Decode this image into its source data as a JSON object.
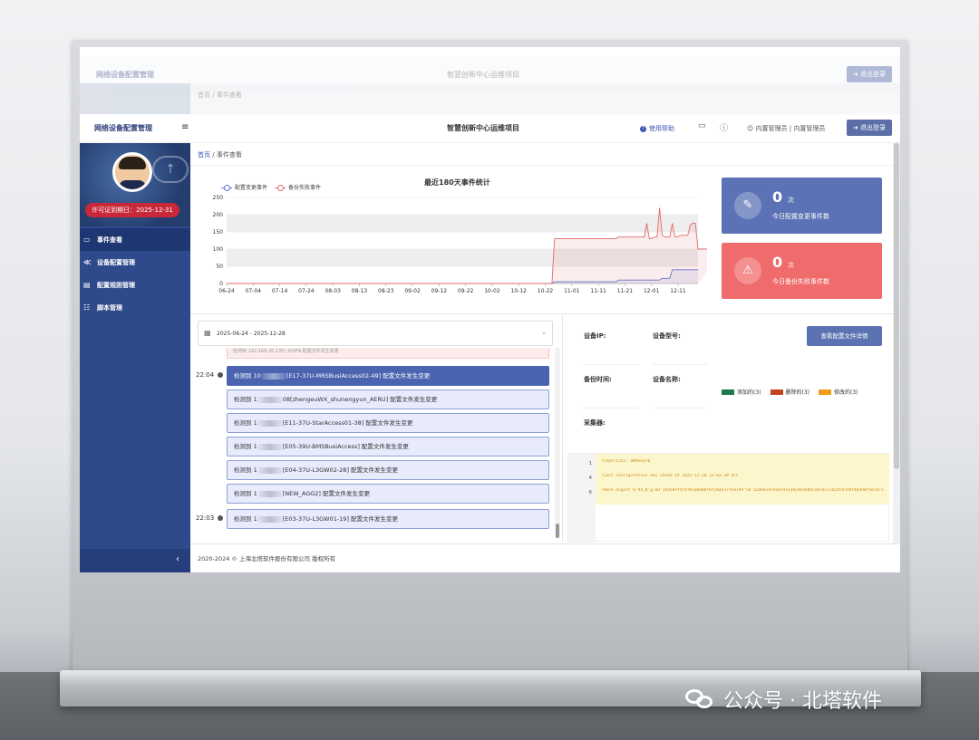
{
  "ghost": {
    "brand": "网络设备配置管理",
    "center_title": "智慧创新中心运维项目",
    "logout": "➜ 退出登录",
    "breadcrumb": "首页 / 事件查看"
  },
  "header": {
    "brand": "网络设备配置管理",
    "menu_toggle": "≡",
    "center_title": "智慧创新中心运维项目",
    "help": "使用帮助",
    "user": "内置管理员 | 内置管理员",
    "logout": "➜ 退出登录"
  },
  "sidebar": {
    "expire": "许可证到期日：2025-12-31",
    "items": [
      {
        "icon": "▭",
        "label": "事件查看",
        "active": true
      },
      {
        "icon": "≪",
        "label": "设备配置管理",
        "active": false
      },
      {
        "icon": "▤",
        "label": "配置规则管理",
        "active": false
      },
      {
        "icon": "☷",
        "label": "脚本管理",
        "active": false
      }
    ],
    "collapse": "‹"
  },
  "breadcrumb": {
    "home": "首页",
    "sep": "/",
    "current": "事件查看"
  },
  "chart_data": {
    "type": "line",
    "title": "最近180天事件统计",
    "series": [
      {
        "name": "配置变更事件",
        "color": "#5b73d6",
        "values": [
          0,
          0,
          0,
          0,
          0,
          0,
          0,
          0,
          0,
          0,
          0,
          0,
          0,
          0,
          0,
          0,
          0,
          0,
          0,
          0,
          0,
          0,
          0,
          0,
          0,
          0,
          0,
          0,
          0,
          0,
          0,
          0,
          0,
          0,
          0,
          0,
          0,
          0,
          0,
          0,
          0,
          0,
          0,
          0,
          0,
          0,
          0,
          0,
          0,
          0,
          0,
          0,
          0,
          0,
          0,
          0,
          0,
          0,
          0,
          0,
          0,
          0,
          0,
          0,
          0,
          0,
          0,
          0,
          0,
          0,
          0,
          0,
          0,
          0,
          0,
          0,
          0,
          0,
          0,
          0,
          0,
          0,
          0,
          0,
          0,
          0,
          0,
          0,
          0,
          0,
          0,
          0,
          0,
          0,
          0,
          0,
          0,
          0,
          0,
          0,
          0,
          0,
          0,
          0,
          0,
          0,
          0,
          0,
          0,
          0,
          0,
          0,
          0,
          0,
          0,
          0,
          0,
          0,
          0,
          0,
          0,
          0,
          0,
          0,
          0,
          0,
          0,
          0,
          5,
          5,
          5,
          5,
          5,
          5,
          5,
          5,
          5,
          5,
          5,
          5,
          5,
          5,
          5,
          5,
          5,
          5,
          5,
          5,
          5,
          5,
          5,
          5,
          5,
          10,
          10,
          10,
          10,
          10,
          10,
          10,
          10,
          10,
          10,
          10,
          10,
          10,
          10,
          10,
          10,
          10,
          15,
          15,
          15,
          15,
          40,
          40,
          40,
          40,
          40,
          40,
          40,
          40,
          40,
          40,
          40
        ]
      },
      {
        "name": "备份失败事件",
        "color": "#e06a6a",
        "values": [
          0,
          0,
          0,
          0,
          0,
          0,
          0,
          0,
          0,
          0,
          0,
          0,
          0,
          0,
          0,
          0,
          0,
          0,
          0,
          0,
          0,
          0,
          0,
          0,
          0,
          0,
          0,
          0,
          0,
          0,
          0,
          0,
          0,
          0,
          0,
          0,
          0,
          0,
          0,
          0,
          0,
          0,
          0,
          0,
          0,
          0,
          0,
          0,
          0,
          0,
          0,
          0,
          0,
          0,
          0,
          0,
          0,
          0,
          0,
          0,
          0,
          0,
          0,
          0,
          0,
          0,
          0,
          0,
          0,
          0,
          0,
          0,
          0,
          0,
          0,
          0,
          0,
          0,
          0,
          0,
          0,
          0,
          0,
          0,
          0,
          0,
          0,
          0,
          0,
          0,
          0,
          0,
          0,
          0,
          0,
          0,
          0,
          0,
          0,
          0,
          0,
          0,
          0,
          0,
          0,
          0,
          0,
          0,
          0,
          0,
          0,
          0,
          0,
          0,
          0,
          0,
          0,
          0,
          0,
          0,
          0,
          0,
          0,
          0,
          0,
          0,
          0,
          0,
          130,
          130,
          130,
          130,
          130,
          130,
          130,
          130,
          130,
          130,
          130,
          130,
          130,
          130,
          130,
          130,
          130,
          130,
          130,
          130,
          130,
          130,
          130,
          130,
          130,
          135,
          135,
          135,
          135,
          135,
          135,
          135,
          135,
          135,
          135,
          135,
          175,
          130,
          130,
          135,
          135,
          220,
          140,
          135,
          135,
          135,
          175,
          135,
          135,
          140,
          140,
          140,
          140,
          170,
          175,
          175,
          100,
          100,
          100,
          100,
          100,
          100,
          100,
          100,
          100,
          100,
          90
        ]
      }
    ],
    "x_ticks": [
      "06-24",
      "07-04",
      "07-14",
      "07-24",
      "08-03",
      "08-13",
      "08-23",
      "09-02",
      "09-12",
      "09-22",
      "10-02",
      "10-12",
      "10-22",
      "11-01",
      "11-11",
      "11-21",
      "12-01",
      "12-11"
    ],
    "y_ticks": [
      "0",
      "50",
      "100",
      "150",
      "200",
      "250"
    ],
    "ylim": [
      0,
      250
    ],
    "grid": "horizontal bands",
    "legend": "top-left"
  },
  "cards": [
    {
      "icon": "✎",
      "value": "0",
      "unit": "次",
      "label": "今日配置变更事件数",
      "color": "#5b73b6"
    },
    {
      "icon": "⚠",
      "value": "0",
      "unit": "次",
      "label": "今日备份失败事件数",
      "color": "#f06b6b"
    }
  ],
  "daterange": "2025-06-24 - 2025-12-28",
  "events": {
    "top_snippet": "检测到 192.168.26.135) 对VPN 配置文件发生变更",
    "groups": [
      {
        "time": "22:04",
        "items": [
          {
            "pre": "检测到 10",
            "post": "[E17-37U-MRSBusiAccess02-49] 配置文件发生变更",
            "selected": true
          },
          {
            "pre": "检测到 1",
            "post": "08[zhengeuWX_shunengyun_AERU] 配置文件发生变更",
            "selected": false
          },
          {
            "pre": "检测到 1",
            "post": "[E11-37U-StarAccess01-38] 配置文件发生变更",
            "selected": false
          },
          {
            "pre": "检测到 1",
            "post": "[E05-39U-BMSBusiAccess] 配置文件发生变更",
            "selected": false
          },
          {
            "pre": "检测到 1",
            "post": "[E04-37U-L3GW02-28] 配置文件发生变更",
            "selected": false
          },
          {
            "pre": "检测到 1",
            "post": "[NEW_AGG2] 配置文件发生变更",
            "selected": false
          }
        ]
      },
      {
        "time": "22:03",
        "items": [
          {
            "pre": "检测到 1",
            "post": "[E03-37U-L3GW01-19] 配置文件发生变更",
            "selected": false
          }
        ]
      }
    ]
  },
  "detail": {
    "device_ip": "设备IP:",
    "device_model": "设备型号:",
    "backup_time": "备份时间:",
    "device_name": "设备名称:",
    "collector": "采集器:",
    "view_button": "查看配置文件详情",
    "tags": [
      {
        "label": "添加的(3)",
        "color": "#1e7a4e"
      },
      {
        "label": "删除的(3)",
        "color": "#c0421e"
      },
      {
        "label": "修改的(3)",
        "color": "#f29b18"
      }
    ],
    "code_lines": [
      {
        "no": "1",
        "text": "!Chgflt2z1: aM9xEQ7B"
      },
      {
        "no": "4",
        "text": "!Last configuration was saved at 2025-12-28 22:03:38 UTC"
      },
      {
        "no": "6",
        "text": "!Hash digest 0'94_8'g:eD'1A5b9ef4f4f0c0bd06f6f2b4e27fe4199'50 52deb2d79aac91e2824d36b6ca9787c1d2df47d6f48398f4d7b71e38"
      }
    ]
  },
  "footer": "2020-2024 © 上海北塔软件股份有限公司  版权所有",
  "watermark": "公众号 · 北塔软件"
}
